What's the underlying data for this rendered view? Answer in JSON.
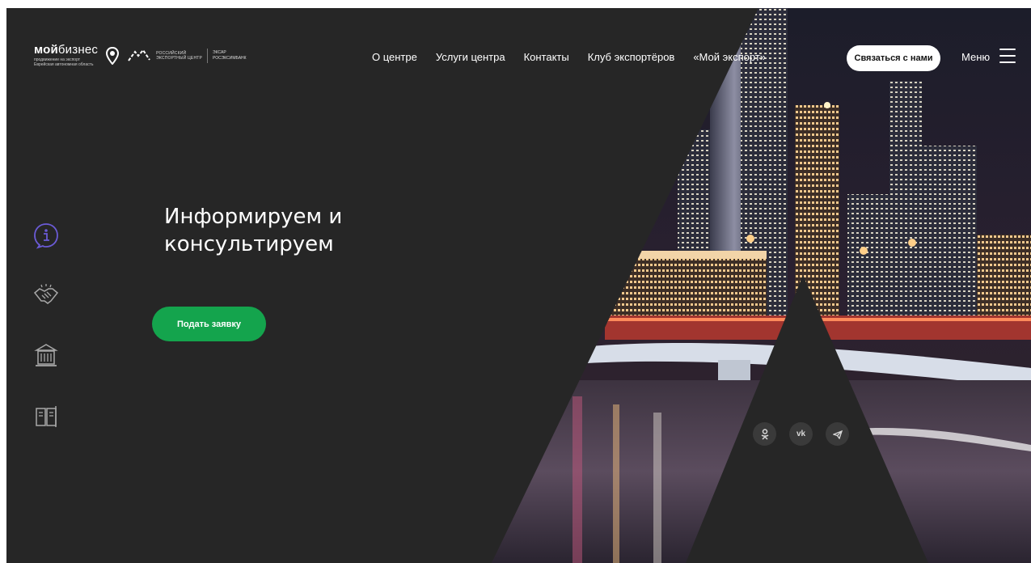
{
  "header": {
    "logo": {
      "brand_prefix": "мой",
      "brand_suffix": "бизнес",
      "brand_sub_1": "продвижение на экспорт",
      "brand_sub_2": "Еврейская автономная область",
      "rec_line_1": "РОССИЙСКИЙ",
      "rec_line_2": "ЭКСПОРТНЫЙ ЦЕНТР",
      "exiar_1": "ЭКСАР",
      "exiar_2": "РОСЭКСИМБАНК"
    },
    "nav": [
      {
        "label": "О центре"
      },
      {
        "label": "Услуги центра"
      },
      {
        "label": "Контакты"
      },
      {
        "label": "Клуб экспортёров"
      },
      {
        "label": "«Мой экспорт»"
      }
    ],
    "contact_button": "Связаться с нами",
    "menu_label": "Меню"
  },
  "rail": [
    {
      "icon": "info-icon",
      "active": true
    },
    {
      "icon": "handshake-icon",
      "active": false
    },
    {
      "icon": "building-icon",
      "active": false
    },
    {
      "icon": "book-icon",
      "active": false
    }
  ],
  "hero": {
    "title": "Информируем и консультируем",
    "apply_button": "Подать заявку"
  },
  "socials": [
    {
      "icon": "odnoklassniki-icon",
      "glyph": "ok"
    },
    {
      "icon": "vk-icon",
      "glyph": "vk"
    },
    {
      "icon": "telegram-icon",
      "glyph": "tg"
    }
  ],
  "colors": {
    "background": "#262626",
    "accent_green": "#14a44d",
    "active_icon": "#6b5bd6"
  }
}
